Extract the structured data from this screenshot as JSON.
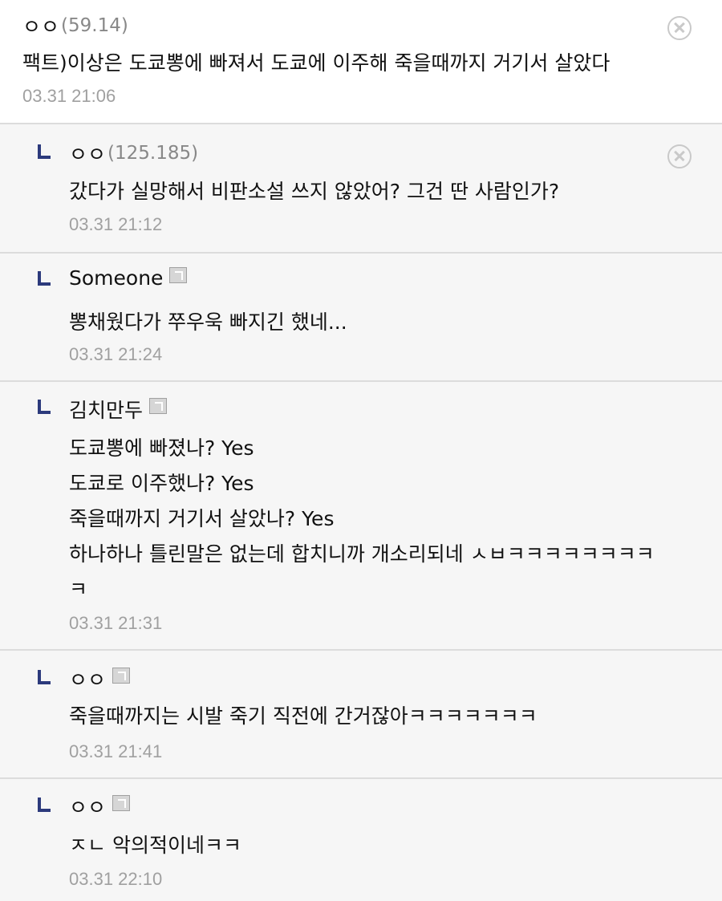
{
  "comments": [
    {
      "nick": "ㅇㅇ",
      "ip": "(59.14)",
      "lines": [
        "팩트)이상은 도쿄뽕에 빠져서 도쿄에 이주해 죽을때까지 거기서 살았다"
      ],
      "date": "03.31 21:06"
    },
    {
      "nick": "ㅇㅇ",
      "ip": "(125.185)",
      "lines": [
        "갔다가 실망해서 비판소설 쓰지 않았어? 그건 딴 사람인가?"
      ],
      "date": "03.31 21:12"
    },
    {
      "nick": "Someone",
      "lines": [
        "뽕채웠다가 쭈우욱 빠지긴 했네..."
      ],
      "date": "03.31 21:24"
    },
    {
      "nick": "김치만두",
      "lines": [
        "도쿄뽕에 빠졌나? Yes",
        "도쿄로 이주했나? Yes",
        "죽을때까지 거기서 살았나? Yes",
        "하나하나 틀린말은 없는데 합치니까 개소리되네 ㅅㅂㅋㅋㅋㅋㅋㅋㅋㅋ",
        "ㅋ"
      ],
      "date": "03.31 21:31"
    },
    {
      "nick": "ㅇㅇ",
      "lines": [
        "죽을때까지는 시발 죽기 직전에 간거잖아ㅋㅋㅋㅋㅋㅋㅋ"
      ],
      "date": "03.31 21:41"
    },
    {
      "nick": "ㅇㅇ",
      "lines": [
        "ㅈㄴ 악의적이네ㅋㅋ"
      ],
      "date": "03.31 22:10"
    }
  ]
}
